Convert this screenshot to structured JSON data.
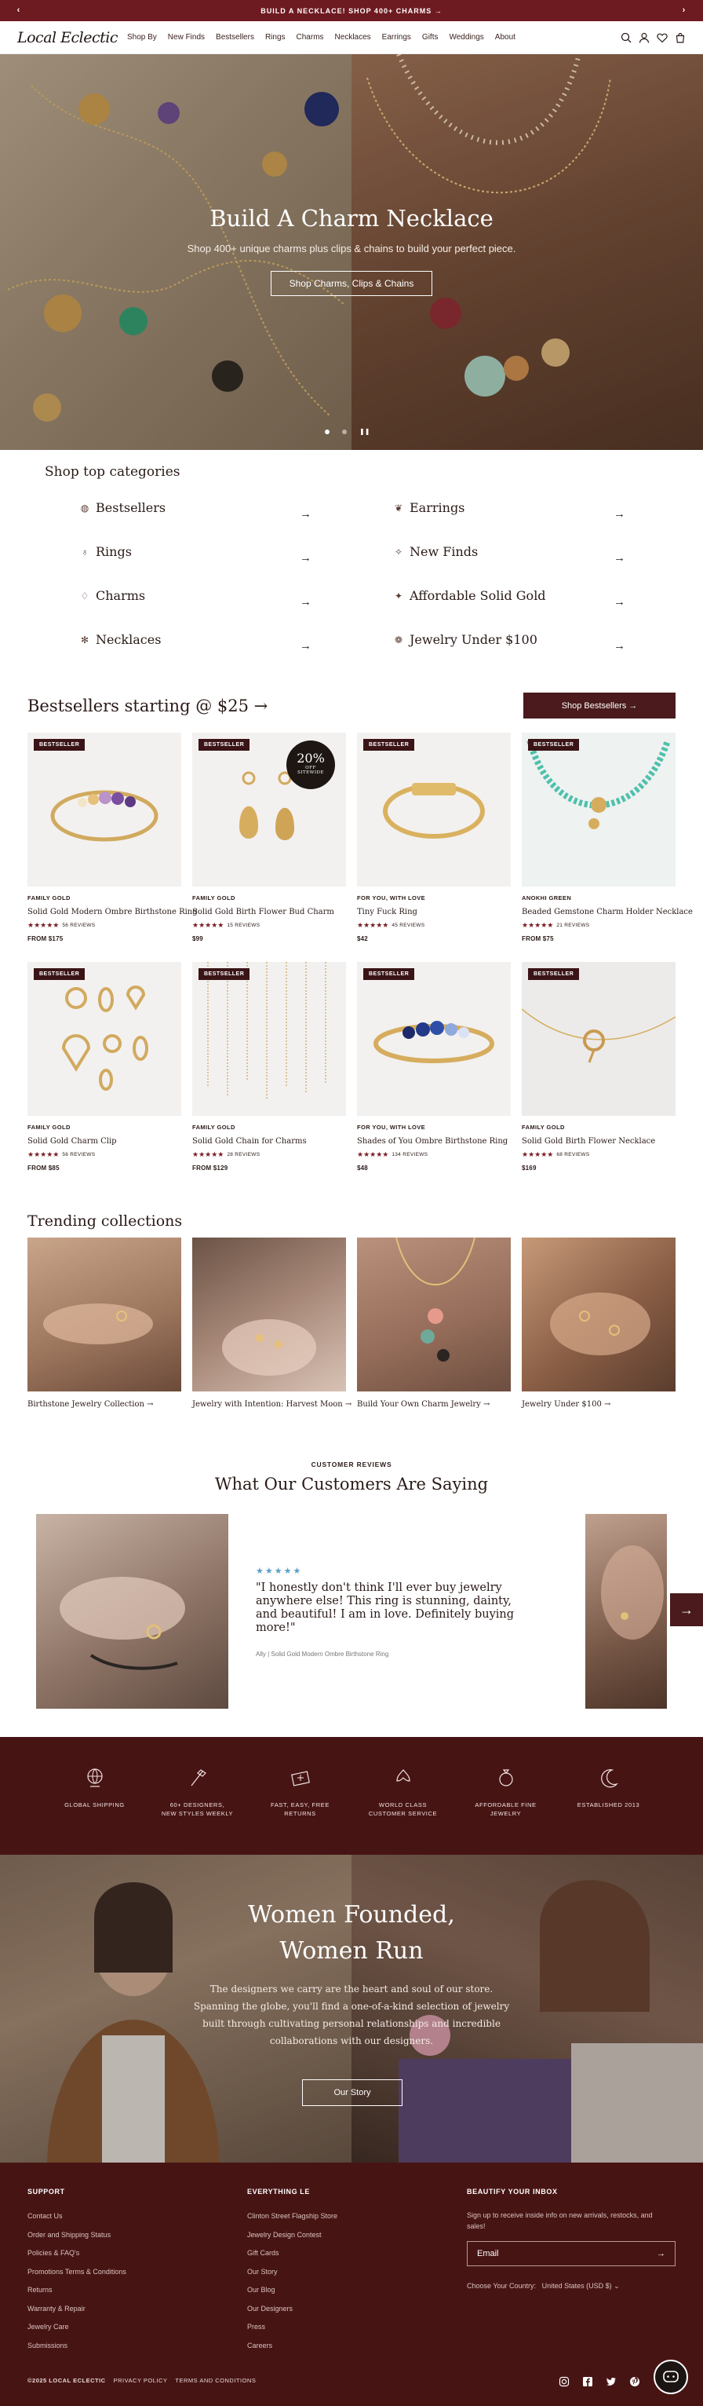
{
  "announcement": {
    "text": "BUILD A NECKLACE! SHOP 400+ CHARMS →"
  },
  "header": {
    "logo": "Local Eclectic",
    "nav": [
      "Shop By",
      "New Finds",
      "Bestsellers",
      "Rings",
      "Charms",
      "Necklaces",
      "Earrings",
      "Gifts",
      "Weddings",
      "About"
    ]
  },
  "hero": {
    "title": "Build A Charm Necklace",
    "subtitle": "Shop 400+ unique charms plus clips & chains to build your perfect piece.",
    "button": "Shop Charms, Clips & Chains"
  },
  "categories": {
    "title": "Shop top categories",
    "items": [
      {
        "label": "Bestsellers",
        "icon": "ring-icon"
      },
      {
        "label": "Earrings",
        "icon": "earring-icon"
      },
      {
        "label": "Rings",
        "icon": "ring-icon"
      },
      {
        "label": "New Finds",
        "icon": "sparkle-icon"
      },
      {
        "label": "Charms",
        "icon": "charm-icon"
      },
      {
        "label": "Affordable Solid Gold",
        "icon": "star-icon"
      },
      {
        "label": "Necklaces",
        "icon": "necklace-icon"
      },
      {
        "label": "Jewelry Under $100",
        "icon": "tag-icon"
      }
    ]
  },
  "bestsellers": {
    "title": "Bestsellers starting @ $25 →",
    "button": "Shop Bestsellers →",
    "products": [
      {
        "badge": "BESTSELLER",
        "brand": "FAMILY GOLD",
        "name": "Solid Gold Modern Ombre Birthstone Ring",
        "reviews": "56 REVIEWS",
        "price": "FROM $175",
        "rating": 4.5
      },
      {
        "badge": "BESTSELLER",
        "brand": "FAMILY GOLD",
        "name": "Solid Gold Birth Flower Bud Charm",
        "reviews": "15 REVIEWS",
        "price": "$99",
        "rating": 4.5,
        "sale": {
          "big": "20%",
          "small": "OFF",
          "tiny": "SITEWIDE"
        }
      },
      {
        "badge": "BESTSELLER",
        "brand": "FOR YOU, WITH LOVE",
        "name": "Tiny Fuck Ring",
        "reviews": "45 REVIEWS",
        "price": "$42",
        "rating": 4.5
      },
      {
        "badge": "BESTSELLER",
        "brand": "ANOKHI GREEN",
        "name": "Beaded Gemstone Charm Holder Necklace",
        "reviews": "21 REVIEWS",
        "price": "FROM $75",
        "rating": 4.5
      },
      {
        "badge": "BESTSELLER",
        "brand": "FAMILY GOLD",
        "name": "Solid Gold Charm Clip",
        "reviews": "56 REVIEWS",
        "price": "FROM $85",
        "rating": 4.5
      },
      {
        "badge": "BESTSELLER",
        "brand": "FAMILY GOLD",
        "name": "Solid Gold Chain for Charms",
        "reviews": "28 REVIEWS",
        "price": "FROM $129",
        "rating": 4.5
      },
      {
        "badge": "BESTSELLER",
        "brand": "FOR YOU, WITH LOVE",
        "name": "Shades of You Ombre Birthstone Ring",
        "reviews": "134 REVIEWS",
        "price": "$48",
        "rating": 4.5
      },
      {
        "badge": "BESTSELLER",
        "brand": "FAMILY GOLD",
        "name": "Solid Gold Birth Flower Necklace",
        "reviews": "68 REVIEWS",
        "price": "$169",
        "rating": 4.5
      }
    ]
  },
  "trending": {
    "title": "Trending collections",
    "items": [
      {
        "label": "Birthstone Jewelry Collection →"
      },
      {
        "label": "Jewelry with Intention: Harvest Moon →"
      },
      {
        "label": "Build Your Own Charm Jewelry →"
      },
      {
        "label": "Jewelry Under $100 →"
      }
    ]
  },
  "reviews": {
    "kicker": "CUSTOMER REVIEWS",
    "title": "What Our Customers Are Saying",
    "stars": "★★★★★",
    "quote": "\"I honestly don't think I'll ever buy jewelry anywhere else! This ring is stunning, dainty, and beautiful! I am in love. Definitely buying more!\"",
    "author": "Ally",
    "product": "Solid Gold Modern Ombre Birthstone Ring"
  },
  "features": [
    {
      "line1": "GLOBAL SHIPPING",
      "line2": "",
      "icon": "globe-icon"
    },
    {
      "line1": "60+ DESIGNERS,",
      "line2": "NEW STYLES WEEKLY",
      "icon": "designer-icon"
    },
    {
      "line1": "FAST, EASY, FREE",
      "line2": "RETURNS",
      "icon": "returns-icon"
    },
    {
      "line1": "WORLD CLASS",
      "line2": "CUSTOMER SERVICE",
      "icon": "service-icon"
    },
    {
      "line1": "AFFORDABLE FINE",
      "line2": "JEWELRY",
      "icon": "ring-icon"
    },
    {
      "line1": "ESTABLISHED 2013",
      "line2": "",
      "icon": "moon-icon"
    }
  ],
  "women_founded": {
    "title_line1": "Women Founded,",
    "title_line2": "Women Run",
    "body": "The designers we carry are the heart and soul of our store. Spanning the globe, you'll find a one-of-a-kind selection of jewelry built through cultivating personal relationships and incredible collaborations with our designers.",
    "button": "Our Story"
  },
  "footer": {
    "support": {
      "heading": "SUPPORT",
      "links": [
        "Contact Us",
        "Order and Shipping Status",
        "Policies & FAQ's",
        "Promotions Terms & Conditions",
        "Returns",
        "Warranty & Repair",
        "Jewelry Care",
        "Submissions"
      ]
    },
    "everything": {
      "heading": "EVERYTHING LE",
      "links": [
        "Clinton Street Flagship Store",
        "Jewelry Design Contest",
        "Gift Cards",
        "Our Story",
        "Our Blog",
        "Our Designers",
        "Press",
        "Careers"
      ]
    },
    "newsletter": {
      "heading": "BEAUTIFY YOUR INBOX",
      "text": "Sign up to receive inside info on new arrivals, restocks, and sales!",
      "placeholder": "Email",
      "country_label": "Choose Your Country:",
      "country_value": "United States (USD $)"
    },
    "bottom": [
      "©2025 LOCAL ECLECTIC",
      "PRIVACY POLICY",
      "TERMS AND CONDITIONS"
    ],
    "social": [
      "instagram-icon",
      "facebook-icon",
      "twitter-icon",
      "pinterest-icon"
    ]
  },
  "colors": {
    "brand": "#6e1a21",
    "dark": "#471414",
    "star": "#7a1c24",
    "review_star": "#5aa0c8"
  }
}
